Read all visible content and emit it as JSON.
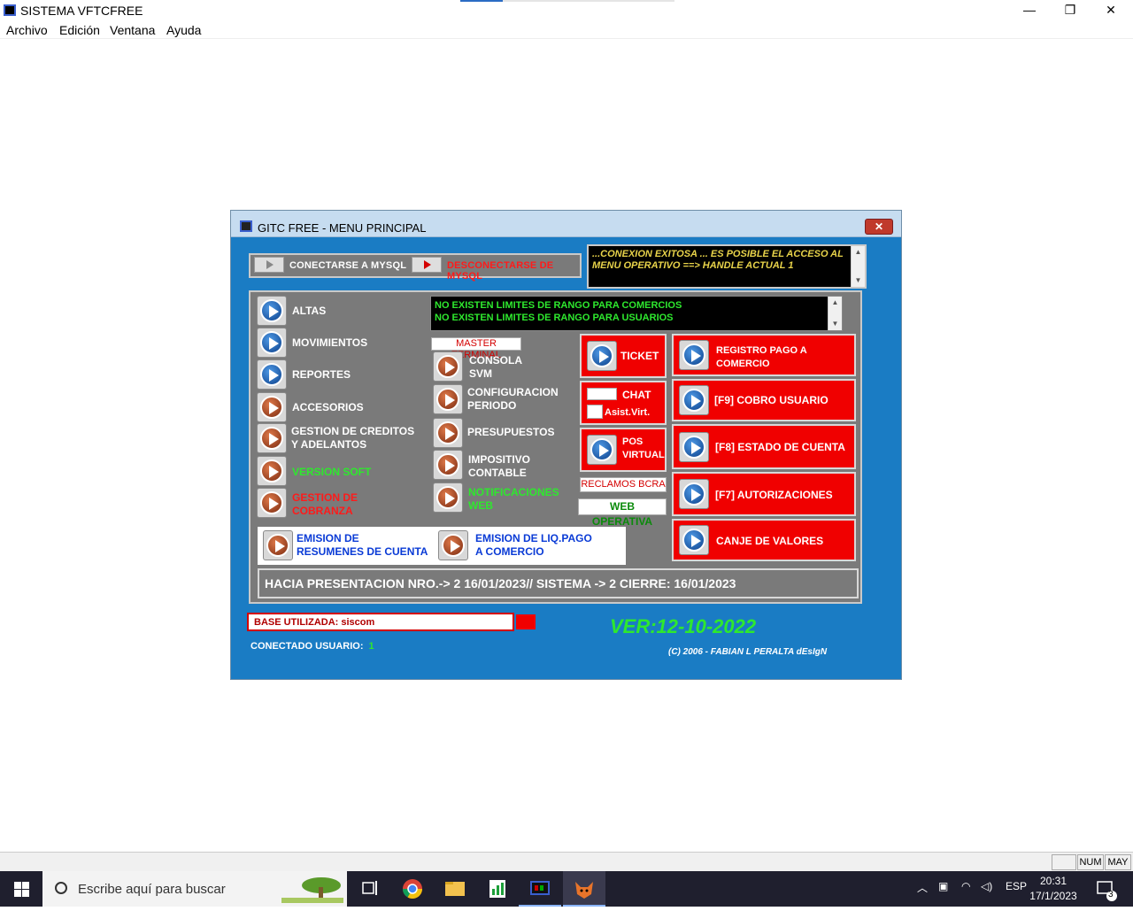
{
  "window": {
    "title": "SISTEMA VFTCFREE",
    "controls": {
      "minimize": "—",
      "restore": "❐",
      "close": "✕"
    }
  },
  "menubar": {
    "items": [
      "Archivo",
      "Edición",
      "Ventana",
      "Ayuda"
    ]
  },
  "dialog": {
    "title": "GITC  FREE - MENU PRINCIPAL",
    "close": "✕",
    "connect": "CONECTARSE A MYSQL",
    "disconnect": "DESCONECTARSE DE MYSQL",
    "status_message": "...CONEXION EXITOSA ... ES POSIBLE EL ACCESO AL MENU OPERATIVO  ==> HANDLE ACTUAL 1",
    "limits": [
      "NO EXISTEN LIMITES DE RANGO PARA COMERCIOS",
      "NO EXISTEN LIMITES DE RANGO PARA USUARIOS"
    ],
    "left_menu": {
      "altas": "ALTAS",
      "movimientos": "MOVIMIENTOS",
      "reportes": "REPORTES",
      "accesorios": "ACCESORIOS",
      "gestion_creditos": "GESTION DE CREDITOS Y ADELANTOS",
      "version_soft": "VERSION SOFT",
      "gestion_cobranza": "GESTION DE COBRANZA"
    },
    "middle_menu": {
      "master_terminal": "MASTER TERMINAL",
      "consola": "CONSOLA SVM",
      "configuracion": "CONFIGURACION PERIODO",
      "presupuestos": "PRESUPUESTOS",
      "impositivo": "IMPOSITIVO CONTABLE",
      "notificaciones": "NOTIFICACIONES WEB"
    },
    "small_col": {
      "ticket": "TICKET",
      "chat": "CHAT",
      "asist": "Asist.Virt.",
      "pos": "POS VIRTUAL",
      "reclamos": "RECLAMOS BCRA",
      "web_operativa": "WEB OPERATIVA"
    },
    "right_menu": {
      "registro_pago": "REGISTRO PAGO A COMERCIO",
      "cobro_usuario": "[F9] COBRO USUARIO",
      "estado_cuenta": "[F8] ESTADO DE CUENTA",
      "autorizaciones": "[F7] AUTORIZACIONES",
      "canje": "CANJE DE VALORES"
    },
    "bottom_buttons": {
      "emision_resumenes": "EMISION DE RESUMENES DE CUENTA",
      "emision_liq": "EMISION DE LIQ.PAGO A COMERCIO"
    },
    "presentacion": "HACIA PRESENTACION NRO.-> 2 16/01/2023// SISTEMA ->  2 CIERRE: 16/01/2023",
    "base": "BASE UTILIZADA: siscom",
    "version": "VER:12-10-2022",
    "connected_user_label": "CONECTADO USUARIO:",
    "connected_user_value": "1",
    "copyright": "(C)  2006 - FABIAN L PERALTA dEsIgN"
  },
  "statusbar": {
    "num": "NUM",
    "may": "MAY"
  },
  "taskbar": {
    "search_placeholder": "Escribe aquí para buscar",
    "lang": "ESP",
    "time": "20:31",
    "date": "17/1/2023",
    "notifications": "3"
  },
  "colors": {
    "dialog_bg": "#1a7cc4",
    "panel_gray": "#7a7a7a",
    "red": "#f00000",
    "green_text": "#2ee82e"
  }
}
